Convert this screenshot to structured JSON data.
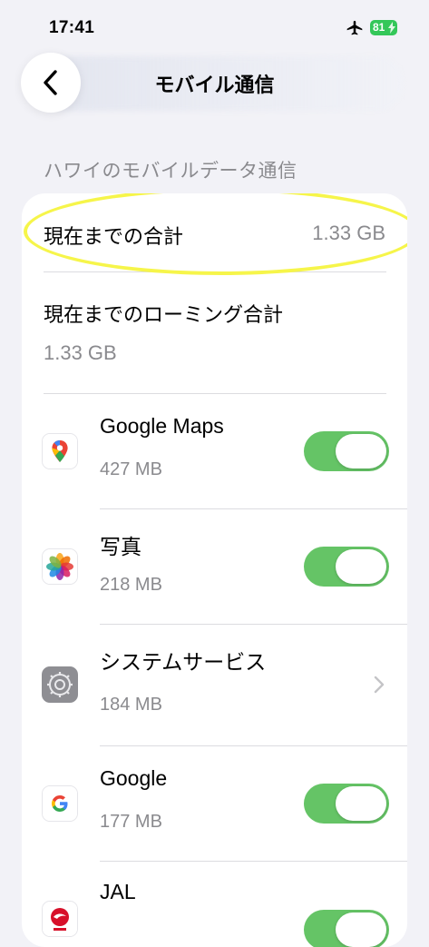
{
  "status_bar": {
    "time": "17:41",
    "battery": "81"
  },
  "nav": {
    "title": "モバイル通信"
  },
  "section": {
    "header": "ハワイのモバイルデータ通信"
  },
  "summary": {
    "total_label": "現在までの合計",
    "total_value": "1.33 GB",
    "roaming_label": "現在までのローミング合計",
    "roaming_value": "1.33 GB"
  },
  "apps": [
    {
      "name": "Google Maps",
      "size": "427 MB",
      "control": "toggle",
      "enabled": true,
      "icon": "google-maps-icon"
    },
    {
      "name": "写真",
      "size": "218 MB",
      "control": "toggle",
      "enabled": true,
      "icon": "photos-icon"
    },
    {
      "name": "システムサービス",
      "size": "184 MB",
      "control": "chevron",
      "icon": "system-services-gear-icon"
    },
    {
      "name": "Google",
      "size": "177 MB",
      "control": "toggle",
      "enabled": true,
      "icon": "google-icon"
    },
    {
      "name": "JAL",
      "size": "",
      "control": "toggle",
      "enabled": true,
      "icon": "jal-icon"
    }
  ],
  "colors": {
    "toggle_on": "#65c466",
    "highlight": "#f6f54a",
    "battery": "#34c759"
  }
}
